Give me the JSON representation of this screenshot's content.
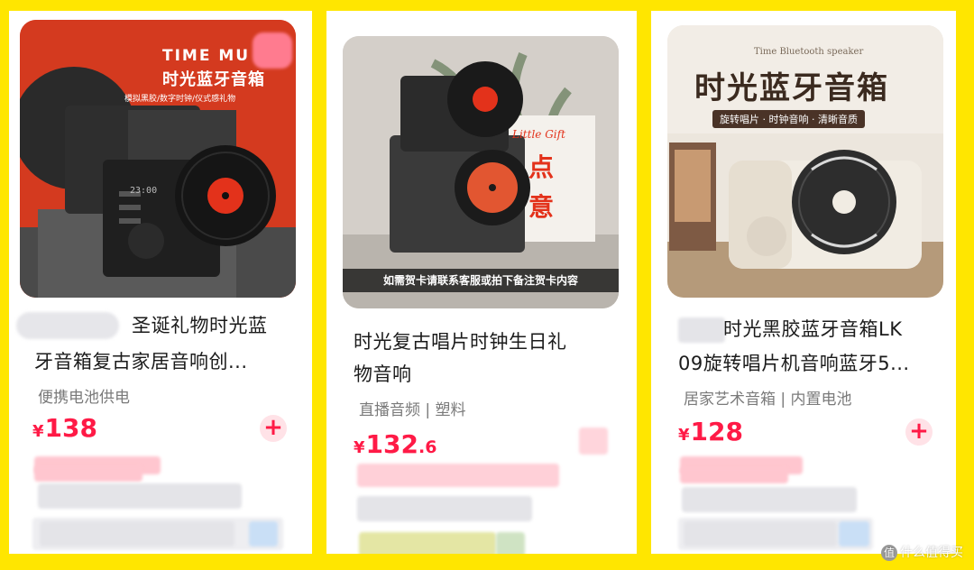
{
  "products": [
    {
      "title_line1": "圣诞礼物时光蓝",
      "title_line2": "牙音箱复古家居音响创...",
      "tags": "便携电池供电",
      "price_symbol": "¥",
      "price_int": "138",
      "price_dec": "",
      "img": {
        "headline": "TIME MU",
        "subhead": "时光蓝牙音箱",
        "caption": "模拟黑胶/数字时钟/仪式感礼物",
        "clock": "23:00"
      }
    },
    {
      "title_line1": "时光复古唱片时钟生日礼",
      "title_line2": "物音响",
      "tags": "直播音频 | 塑料",
      "price_symbol": "¥",
      "price_int": "132",
      "price_dec": ".6",
      "img": {
        "note": "如需贺卡请联系客服或拍下备注贺卡内容",
        "bag_text": "Little Gift",
        "bag_big1": "点",
        "bag_big2": "意"
      }
    },
    {
      "title_line1": "时光黑胶蓝牙音箱LK",
      "title_line2": "09旋转唱片机音响蓝牙5...",
      "tags": "居家艺术音箱 | 内置电池",
      "price_symbol": "¥",
      "price_int": "128",
      "price_dec": "",
      "img": {
        "small": "Time Bluetooth speaker",
        "headline": "时光蓝牙音箱",
        "caption": "旋转唱片 · 时钟音响 · 清晰音质"
      }
    }
  ],
  "watermark": "什么值得买",
  "watermark_icon": "值"
}
